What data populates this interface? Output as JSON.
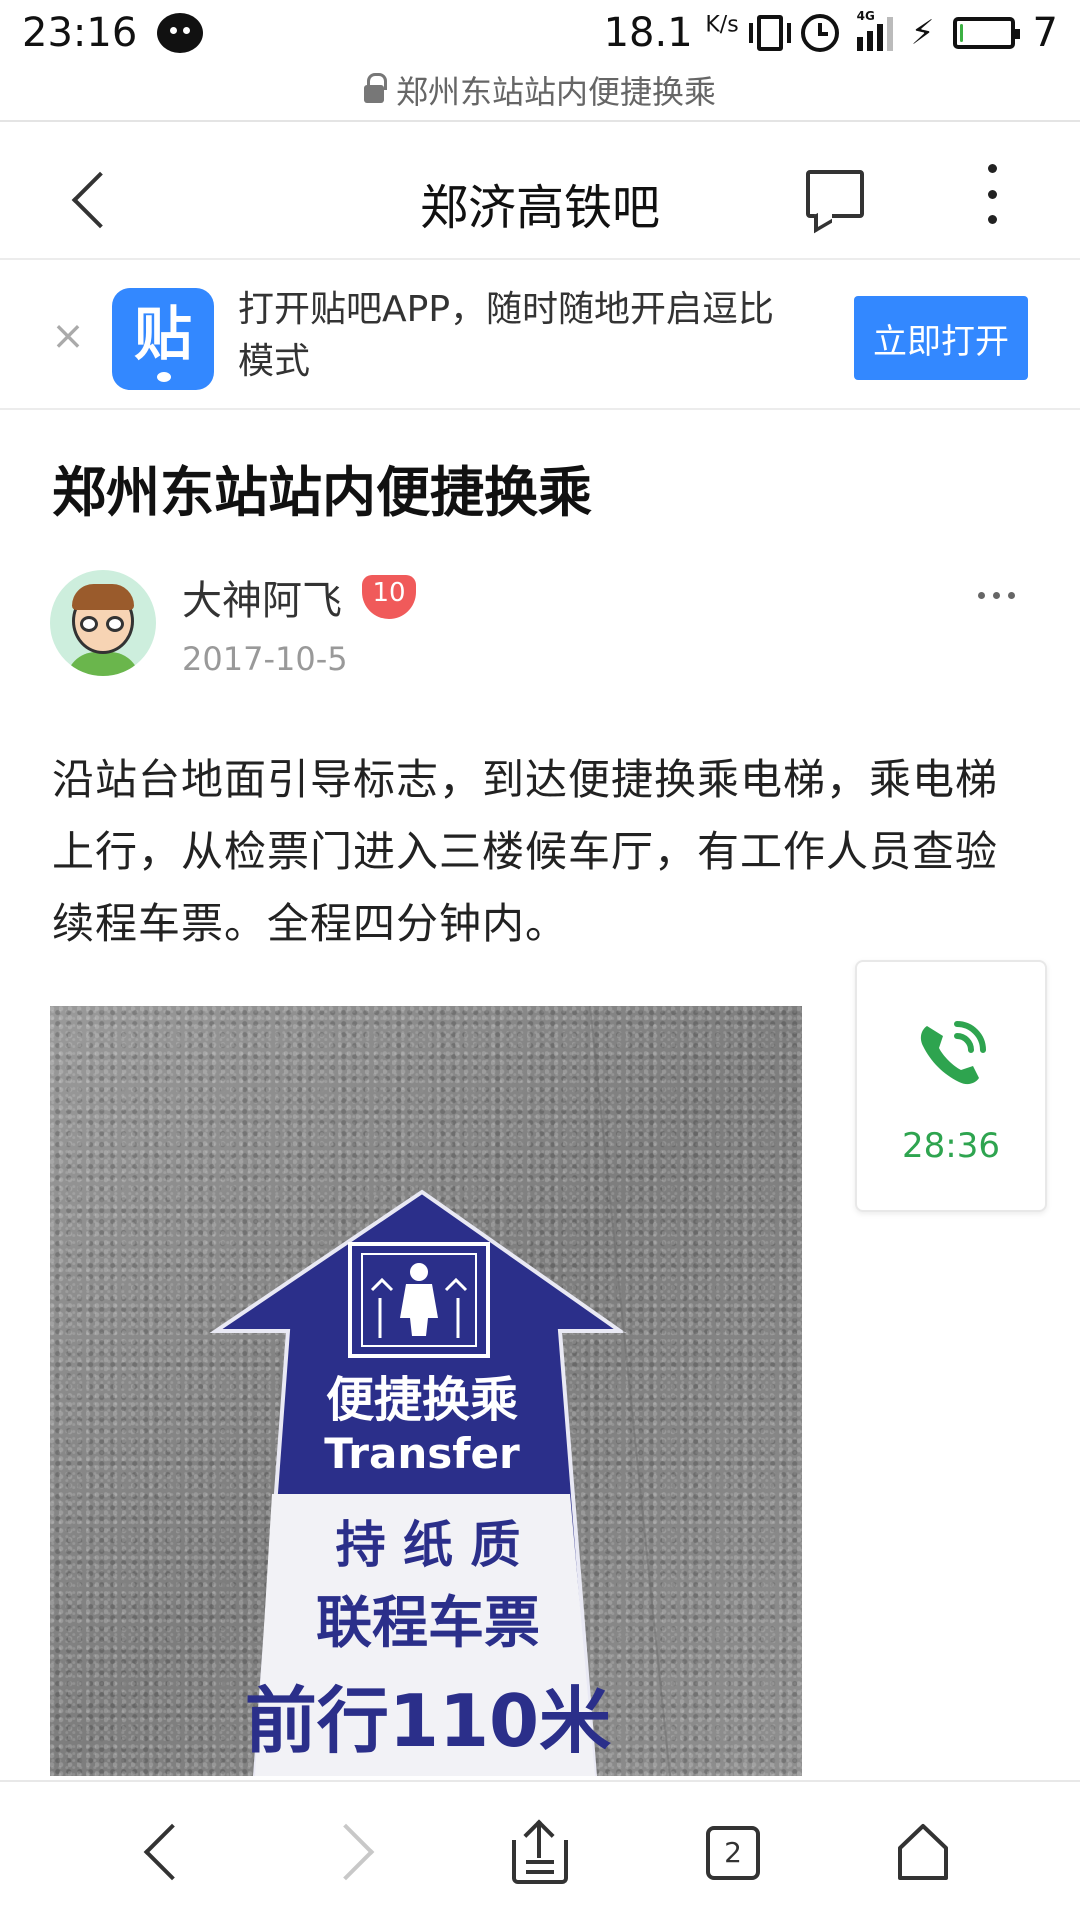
{
  "status_bar": {
    "time": "23:16",
    "speed": "18.1",
    "speed_unit": "K/s",
    "network": "4G",
    "battery_level": "7",
    "icons": [
      "wechat-icon",
      "vibrate-icon",
      "alarm-icon",
      "signal-icon",
      "charging-icon",
      "battery-icon"
    ]
  },
  "url_bar": {
    "title": "郑州东站站内便捷换乘",
    "icon": "lock-icon"
  },
  "header": {
    "title": "郑济高铁吧",
    "icons": [
      "back-icon",
      "comment-icon",
      "more-vertical-icon"
    ]
  },
  "app_banner": {
    "logo_text": "贴",
    "text": "打开贴吧APP，随时随地开启逗比模式",
    "button": "立即打开",
    "accent": "#3388ff"
  },
  "post": {
    "title": "郑州东站站内便捷换乘",
    "author": "大神阿飞",
    "level": "10",
    "date": "2017-10-5",
    "content": "沿站台地面引导标志，到达便捷换乘电梯，乘电梯上行，从检票门进入三楼候车厅，有工作人员查验续程车票。全程四分钟内。",
    "image": {
      "sign_title": "便捷换乘",
      "sign_subtitle": "Transfer",
      "sign_line1": "持 纸 质",
      "sign_line2": "联程车票",
      "sign_line3": "前行110米"
    }
  },
  "call_widget": {
    "duration": "28:36",
    "color": "#2ea44f"
  },
  "bottom_nav": {
    "tab_count": "2",
    "icons": [
      "nav-back-icon",
      "nav-forward-icon",
      "share-icon",
      "tabs-icon",
      "home-icon"
    ]
  }
}
